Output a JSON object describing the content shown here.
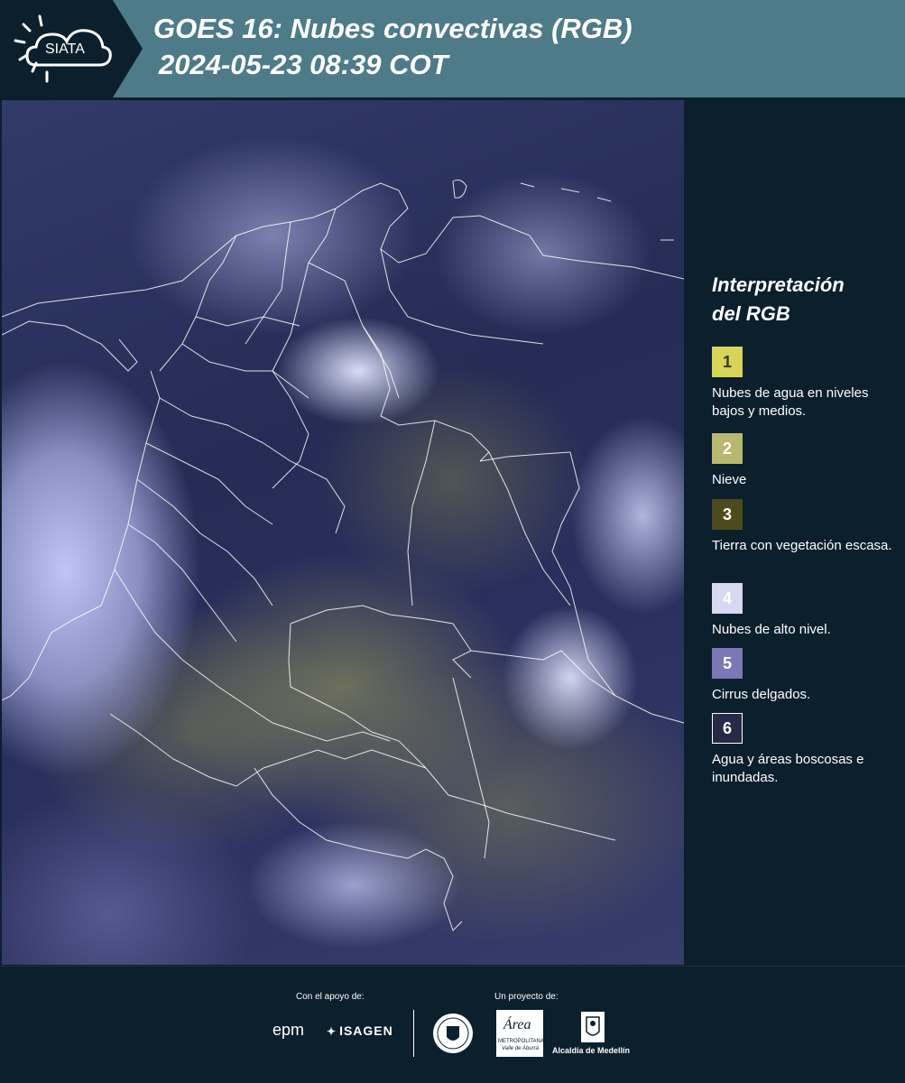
{
  "header": {
    "logo_text": "SIATA",
    "title_line1": "GOES 16: Nubes convectivas (RGB)",
    "title_line2": "2024-05-23 08:39 COT"
  },
  "legend": {
    "title_line1": "Interpretación",
    "title_line2": "del RGB",
    "items": [
      {
        "number": "1",
        "label": "Nubes de agua en niveles bajos y medios.",
        "color": "#d7d45a",
        "text_color": "#3b3a20"
      },
      {
        "number": "2",
        "label": "Nieve",
        "color": "#b8b76f",
        "text_color": "#ffffff"
      },
      {
        "number": "3",
        "label": "Tierra con vegetación escasa.",
        "color": "#4d4b1b",
        "text_color": "#ffffff"
      },
      {
        "number": "4",
        "label": "Nubes de alto nivel.",
        "color": "#d8d8f3",
        "text_color": "#ffffff"
      },
      {
        "number": "5",
        "label": "Cirrus delgados.",
        "color": "#7c78b8",
        "text_color": "#ffffff"
      },
      {
        "number": "6",
        "label": "Agua y áreas boscosas e inundadas.",
        "color": "#262a44",
        "text_color": "#ffffff"
      }
    ]
  },
  "footer": {
    "support_label": "Con el apoyo de:",
    "project_label": "Un proyecto de:",
    "epm": "epm",
    "isagen": "ISAGEN",
    "area_text": "Área",
    "area_sub": "METROPOLITANA",
    "area_sub2": "Valle de Aburrá",
    "alcaldia": "Alcaldía de Medellín"
  },
  "colors": {
    "header_bg": "#4e7b88",
    "logo_bg": "#0b1f2c",
    "page_bg": "#0b1f2c"
  }
}
